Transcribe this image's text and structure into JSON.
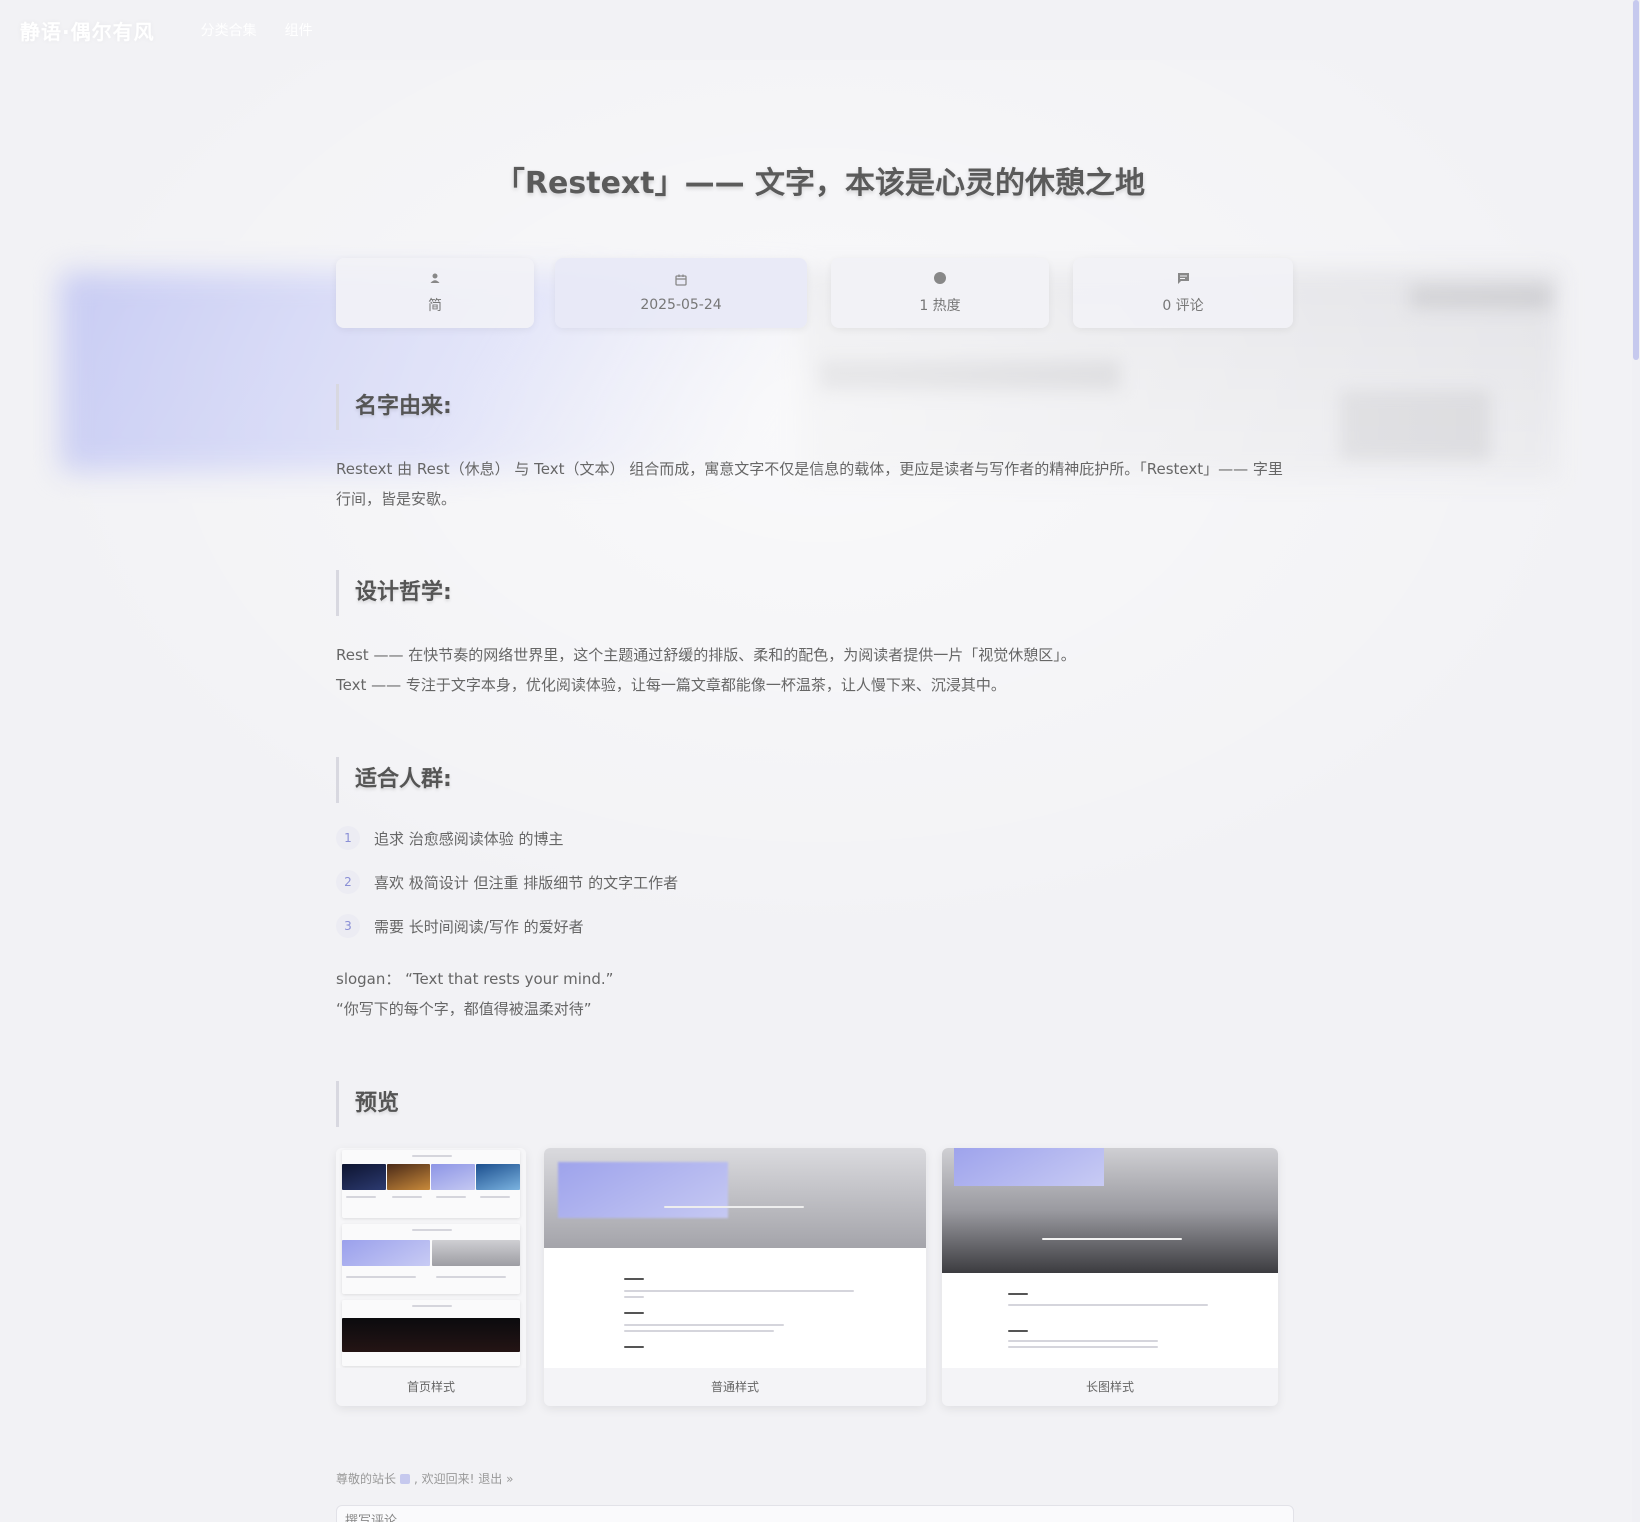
{
  "nav": {
    "brand": "静语·偶尔有风",
    "links": [
      "分类合集",
      "组件"
    ]
  },
  "post": {
    "title": "「Restext」—— 文字，本该是心灵的休憩之地",
    "meta": {
      "author": "简",
      "date": "2025-05-24",
      "views": "1 热度",
      "comments": "0 评论"
    },
    "sections": {
      "name": {
        "heading": "名字由来:",
        "body_line1": "Restext 由 Rest（休息） 与 Text（文本） 组合而成，寓意文字不仅是信息的载体，更应是读者与写作者的精神庇护所。「Restext」—— 字里",
        "body_line2": "行间，皆是安歇。"
      },
      "design": {
        "heading": "设计哲学:",
        "line1": "Rest —— 在快节奏的网络世界里，这个主题通过舒缓的排版、柔和的配色，为阅读者提供一片「视觉休憩区」。",
        "line2": "Text —— 专注于文字本身，优化阅读体验，让每一篇文章都能像一杯温茶，让人慢下来、沉浸其中。"
      },
      "audience": {
        "heading": "适合人群:",
        "items": [
          {
            "num": "1",
            "text": "追求 治愈感阅读体验 的博主"
          },
          {
            "num": "2",
            "text": "喜欢 极简设计 但注重 排版细节 的文字工作者"
          },
          {
            "num": "3",
            "text": "需要 长时间阅读/写作 的爱好者"
          }
        ]
      },
      "slogan": {
        "line1": "slogan：  “Text that rests your mind.”",
        "line2": " “你写下的每个字，都值得被温柔对待”"
      },
      "preview": {
        "heading": "预览",
        "cards": [
          {
            "caption": "首页样式"
          },
          {
            "caption": "普通样式"
          },
          {
            "caption": "长图样式"
          }
        ]
      }
    }
  },
  "comments": {
    "welcome_prefix": "尊敬的站长",
    "welcome_suffix": ", 欢迎回来!",
    "logout": "退出 »",
    "placeholder": "撰写评论"
  },
  "colors": {
    "accent": "#8a8fd6",
    "accent_light": "#c6c9ee",
    "background": "#f2f2f5"
  },
  "icons": {
    "author": "user-icon",
    "date": "calendar-icon",
    "views": "dot-icon",
    "comments": "comment-icon"
  }
}
